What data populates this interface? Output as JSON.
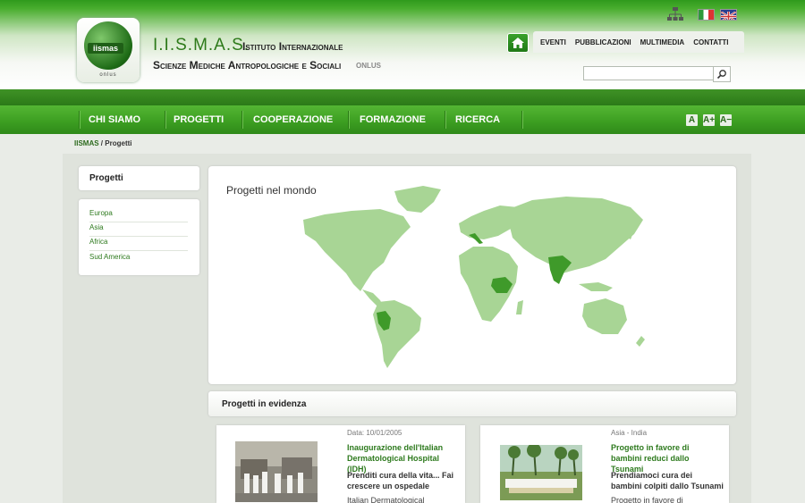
{
  "header": {
    "brand": "I.I.S.M.A.S.",
    "brand_line1": "Istituto Internazionale",
    "brand_line2": "Scienze Mediche Antropologiche e Sociali",
    "onlus": "ONLUS",
    "logo_badge": "iismas",
    "logo_onlus": "onlus"
  },
  "top_nav": [
    "EVENTI",
    "PUBBLICAZIONI",
    "MULTIMEDIA",
    "CONTATTI"
  ],
  "search": {
    "value": ""
  },
  "main_nav": [
    "CHI SIAMO",
    "PROGETTI",
    "COOPERAZIONE",
    "FORMAZIONE",
    "RICERCA"
  ],
  "font_buttons": [
    "A",
    "A+",
    "A−"
  ],
  "breadcrumb": {
    "root": "IISMAS",
    "separator": "/",
    "current": "Progetti"
  },
  "sidebar": {
    "title": "Progetti",
    "items": [
      "Europa",
      "Asia",
      "Africa",
      "Sud America"
    ]
  },
  "map": {
    "title": "Progetti nel mondo",
    "colors": {
      "land": "#a8d595",
      "highlight": "#3f9a2a"
    },
    "highlighted_countries": [
      "Italy",
      "Ethiopia",
      "India",
      "Peru"
    ]
  },
  "featured": {
    "title": "Progetti in evidenza",
    "cards": [
      {
        "meta": "Data: 10/01/2005",
        "headline": "Inaugurazione dell'Italian Dermatological Hospital (IDH)",
        "subtitle": "Prenditi cura della vita... Fai crescere un ospedale",
        "body": "Italian Dermatological"
      },
      {
        "meta": "Asia - India",
        "headline": "Progetto in favore di bambini reduci dallo Tsunami",
        "subtitle": "Prendiamoci cura dei bambini colpiti dallo Tsunami",
        "body": "Progetto in favore di"
      }
    ]
  }
}
